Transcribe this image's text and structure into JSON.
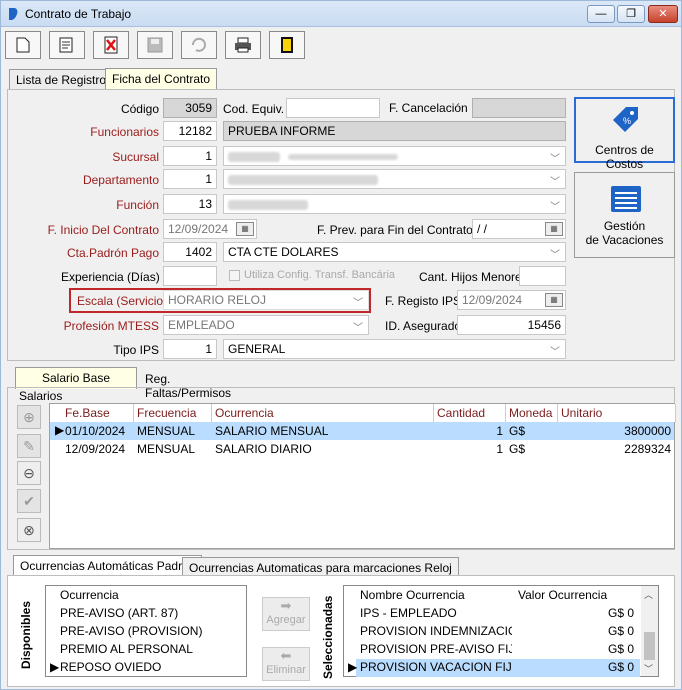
{
  "window": {
    "title": "Contrato de Trabajo",
    "min": "—",
    "max": "❐",
    "close": "✕"
  },
  "tabs": {
    "lista": "Lista de Registros",
    "ficha": "Ficha del Contrato"
  },
  "form": {
    "codigo_label": "Código",
    "codigo": "3059",
    "cod_equiv_label": "Cod. Equiv.",
    "cod_equiv": "",
    "f_cancel_label": "F. Cancelación",
    "funcionarios_label": "Funcionarios",
    "funcionarios_id": "12182",
    "funcionarios_name": "PRUEBA INFORME",
    "sucursal_label": "Sucursal",
    "sucursal_id": "1",
    "departamento_label": "Departamento",
    "departamento_id": "1",
    "funcion_label": "Función",
    "funcion_id": "13",
    "f_inicio_label": "F. Inicio Del Contrato",
    "f_inicio": "12/09/2024",
    "f_prev_label": "F. Prev. para Fin del Contrato",
    "f_prev": " / /",
    "cta_label": "Cta.Padrón Pago",
    "cta_id": "1402",
    "cta_name": "CTA CTE DOLARES",
    "experiencia_label": "Experiencia (Días)",
    "experiencia": "",
    "utiliza_label": "Utiliza Config. Transf. Bancária",
    "hijos_label": "Cant. Hijos Menores",
    "hijos": "",
    "escala_label": "Escala (Servicio)",
    "escala": "HORARIO RELOJ",
    "f_registro_label": "F. Registo IPS",
    "f_registro": "12/09/2024",
    "profesion_label": "Profesión MTESS",
    "profesion": "EMPLEADO",
    "id_asegurado_label": "ID. Asegurado",
    "id_asegurado": "15456",
    "tipo_ips_label": "Tipo IPS",
    "tipo_ips_id": "1",
    "tipo_ips": "GENERAL"
  },
  "side_buttons": {
    "centros": "Centros de Costos",
    "gestion_1": "Gestión",
    "gestion_2": "de Vacaciones"
  },
  "subtabs": {
    "salario": "Salario Base",
    "faltas": "Reg. Faltas/Permisos"
  },
  "salarios": {
    "group": "Salarios",
    "headers": [
      "Fe.Base",
      "Frecuencia",
      "Ocurrencia",
      "Cantidad",
      "Moneda",
      "Unitario"
    ],
    "rows": [
      [
        "01/10/2024",
        "MENSUAL",
        "SALARIO MENSUAL",
        "1",
        "G$",
        "3800000"
      ],
      [
        "12/09/2024",
        "MENSUAL",
        "SALARIO DIARIO",
        "1",
        "G$",
        "2289324"
      ]
    ]
  },
  "bottom_tabs": {
    "padron": "Ocurrencias Automáticas Padrón",
    "reloj": "Ocurrencias Automaticas para marcaciones Reloj"
  },
  "disponibles": {
    "label": "Disponibles",
    "header": "Ocurrencia",
    "items": [
      "PRE-AVISO (ART. 87)",
      "PRE-AVISO (PROVISION)",
      "PREMIO AL PERSONAL",
      "REPOSO OVIEDO"
    ]
  },
  "actions": {
    "agregar": "Agregar",
    "eliminar": "Eliminar"
  },
  "seleccionadas": {
    "label": "Seleccionadas",
    "h_nombre": "Nombre Ocurrencia",
    "h_valor": "Valor Ocurrencia",
    "rows": [
      [
        "IPS - EMPLEADO",
        "G$ 0"
      ],
      [
        "PROVISION INDEMNIZACION F",
        "G$ 0"
      ],
      [
        "PROVISION PRE-AVISO FIJO",
        "G$ 0"
      ],
      [
        "PROVISION VACACION FIJO",
        "G$ 0"
      ]
    ]
  },
  "colors": {
    "accent_red": "#9b1b1b",
    "selected_row": "#b9dcff",
    "highlight_border": "#c0272d",
    "icon_blue": "#1e63c6"
  }
}
